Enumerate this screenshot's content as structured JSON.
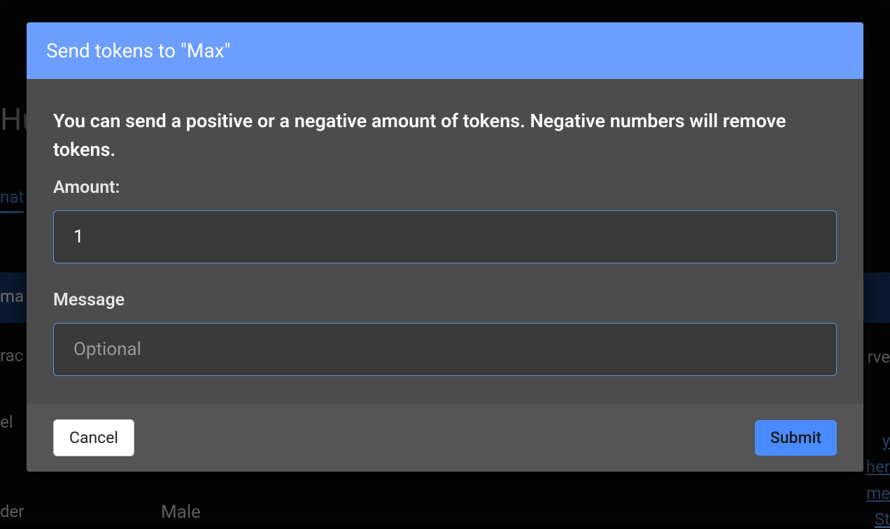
{
  "background": {
    "title_fragment": "Hu",
    "tab_fragment": "nat",
    "active_row_fragment": "ma",
    "label_trac": "rac",
    "label_el": "el",
    "label_der": "der",
    "value_male": "Male",
    "right_serve": "rve",
    "right_link_1": "y",
    "right_link_2": "her",
    "right_link_3": "me",
    "right_link_4": "St"
  },
  "modal": {
    "title": "Send tokens to \"Max\"",
    "description": "You can send a positive or a negative amount of tokens. Negative numbers will remove tokens.",
    "amount_label": "Amount:",
    "amount_value": "1",
    "message_label": "Message",
    "message_placeholder": "Optional",
    "message_value": "",
    "cancel_label": "Cancel",
    "submit_label": "Submit"
  }
}
